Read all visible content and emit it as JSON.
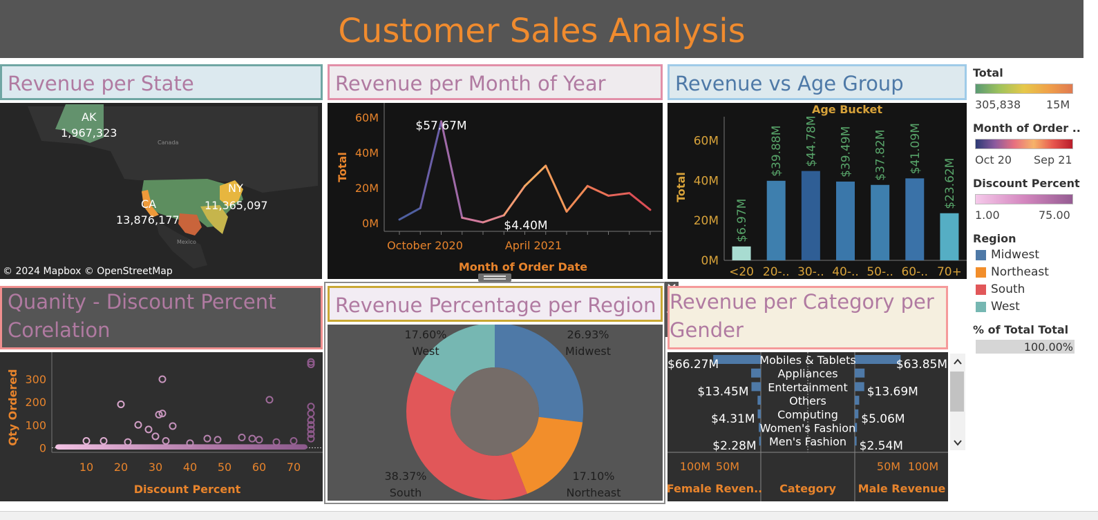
{
  "dashboard": {
    "title": "Customer Sales Analysis",
    "colors": {
      "title_bg": "#555555",
      "title_text": "#f08b2e",
      "panel_title_text": "#b07aa1"
    }
  },
  "map_panel": {
    "title": "Revenue per State",
    "labels": [
      {
        "state": "AK",
        "value": "1,967,323"
      },
      {
        "state": "CA",
        "value": "13,876,177"
      },
      {
        "state": "NY",
        "value": "11,365,097"
      }
    ],
    "place_labels": [
      "Canada",
      "Mexico"
    ],
    "attribution": "© 2024 Mapbox © OpenStreetMap"
  },
  "month_panel": {
    "title": "Revenue per Month of Year"
  },
  "age_panel": {
    "title": "Revenue vs Age Group"
  },
  "scatter_panel": {
    "title": "Quanity - Discount Percent Corelation"
  },
  "region_panel": {
    "title": "Revenue Percentage per Region",
    "toolbar_icons": [
      "close-icon",
      "popout-icon",
      "filter-icon",
      "more-icon"
    ]
  },
  "category_panel": {
    "title": "Revenue per Category per Gender"
  },
  "legends": {
    "total": {
      "title": "Total",
      "min": "305,838",
      "max": "15M"
    },
    "month": {
      "title": "Month of Order ..",
      "min": "Oct 20",
      "max": "Sep 21"
    },
    "discount": {
      "title": "Discount Percent",
      "min": "1.00",
      "max": "75.00"
    },
    "region": {
      "title": "Region",
      "items": [
        {
          "name": "Midwest",
          "color": "#4e79a7"
        },
        {
          "name": "Northeast",
          "color": "#f28e2b"
        },
        {
          "name": "South",
          "color": "#e15759"
        },
        {
          "name": "West",
          "color": "#76b7b2"
        }
      ]
    },
    "percent_total": {
      "title": "% of Total Total",
      "value": "100.00%"
    }
  },
  "chart_data": [
    {
      "id": "month",
      "type": "line",
      "xlabel": "Month of Order Date",
      "ylabel": "Total",
      "y_ticks": [
        "0M",
        "20M",
        "40M",
        "60M"
      ],
      "x_ticks": [
        "October 2020",
        "April 2021"
      ],
      "ylim": [
        0,
        65
      ],
      "values": [
        2,
        8.5,
        57.67,
        3,
        0.4,
        4.4,
        21,
        32.5,
        6.5,
        21,
        15.5,
        17,
        7.5
      ],
      "annotations": [
        {
          "index": 2,
          "label": "$57.67M"
        },
        {
          "index": 5,
          "label": "$4.40M"
        }
      ]
    },
    {
      "id": "age",
      "type": "bar",
      "title": "Age Bucket",
      "ylabel": "Total",
      "y_ticks": [
        "0M",
        "20M",
        "40M",
        "60M"
      ],
      "ylim": [
        0,
        72
      ],
      "categories": [
        "<20",
        "20-..",
        "30-..",
        "40-..",
        "50-..",
        "60-..",
        "70+"
      ],
      "values": [
        6.97,
        39.88,
        44.78,
        39.49,
        37.82,
        41.09,
        23.62
      ],
      "labels": [
        "$6.97M",
        "$39.88M",
        "$44.78M",
        "$39.49M",
        "$37.82M",
        "$41.09M",
        "$23.62M"
      ],
      "colors": [
        "#a8dcd1",
        "#3e7fae",
        "#2f5e95",
        "#3a77aa",
        "#3e7fae",
        "#3a72a8",
        "#55aec4"
      ]
    },
    {
      "id": "scatter",
      "type": "scatter",
      "xlabel": "Discount Percent",
      "ylabel": "Qty Ordered",
      "x_ticks": [
        10,
        20,
        30,
        40,
        50,
        60,
        70
      ],
      "y_ticks": [
        0,
        100,
        200,
        300
      ],
      "xlim": [
        0,
        77
      ],
      "ylim": [
        -20,
        400
      ],
      "points": [
        [
          20,
          190
        ],
        [
          32,
          300
        ],
        [
          31,
          145
        ],
        [
          32,
          150
        ],
        [
          25,
          100
        ],
        [
          28,
          80
        ],
        [
          35,
          95
        ],
        [
          63,
          210
        ],
        [
          75,
          375
        ],
        [
          75,
          365
        ],
        [
          75,
          180
        ],
        [
          75,
          150
        ],
        [
          75,
          120
        ],
        [
          75,
          100
        ],
        [
          75,
          80
        ],
        [
          75,
          60
        ],
        [
          75,
          40
        ],
        [
          10,
          30
        ],
        [
          15,
          30
        ],
        [
          22,
          25
        ],
        [
          30,
          50
        ],
        [
          33,
          30
        ],
        [
          45,
          40
        ],
        [
          48,
          35
        ],
        [
          55,
          45
        ],
        [
          58,
          40
        ],
        [
          60,
          35
        ],
        [
          70,
          30
        ],
        [
          40,
          20
        ],
        [
          65,
          25
        ]
      ]
    },
    {
      "id": "region",
      "type": "pie",
      "slices": [
        {
          "name": "Midwest",
          "percent": 26.93,
          "label": "26.93%",
          "color": "#4e79a7"
        },
        {
          "name": "Northeast",
          "percent": 17.1,
          "label": "17.10%",
          "color": "#f28e2b"
        },
        {
          "name": "South",
          "percent": 38.37,
          "label": "38.37%",
          "color": "#e15759"
        },
        {
          "name": "West",
          "percent": 17.6,
          "label": "17.60%",
          "color": "#76b7b2"
        }
      ]
    },
    {
      "id": "category",
      "type": "bar",
      "categories": [
        "Mobiles & Tablets",
        "Appliances",
        "Entertainment",
        "Others",
        "Computing",
        "Women's Fashion",
        "Men's Fashion"
      ],
      "female_values": [
        66.27,
        13.45,
        13.0,
        4.5,
        4.31,
        2.8,
        2.28
      ],
      "male_values": [
        63.85,
        13.69,
        13.2,
        6.2,
        5.06,
        3.1,
        2.54
      ],
      "female_labels": [
        "$66.27M",
        "",
        "$13.45M",
        "",
        "$4.31M",
        "",
        "$2.28M"
      ],
      "male_labels": [
        "$63.85M",
        "",
        "$13.69M",
        "",
        "$5.06M",
        "",
        "$2.54M"
      ],
      "x_ticks_female": [
        "100M",
        "50M"
      ],
      "x_ticks_male": [
        "50M",
        "100M"
      ],
      "xlabels": [
        "Female Reven..",
        "Category",
        "Male Revenue"
      ]
    }
  ]
}
